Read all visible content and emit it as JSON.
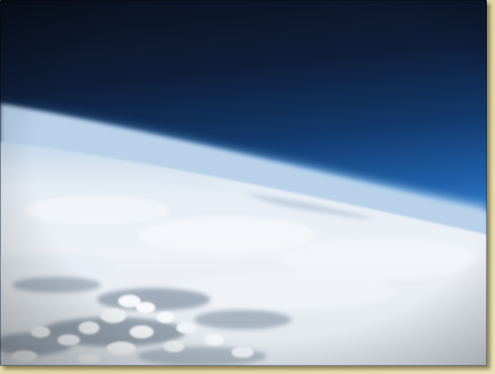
{
  "image": {
    "subject": "earth-horizon-from-stratosphere",
    "colors": {
      "space": "#0b1323",
      "deep_sky": "#12325f",
      "sky_blue": "#2f7fd0",
      "horizon_glow": "#8ec0ea",
      "haze": "#c9dbec",
      "cloud": "#f1f4f8",
      "cloud_shadow": "#9aa7b8",
      "ground_gaps": "#6f7e8a",
      "matte": "#e9dfb3"
    }
  }
}
